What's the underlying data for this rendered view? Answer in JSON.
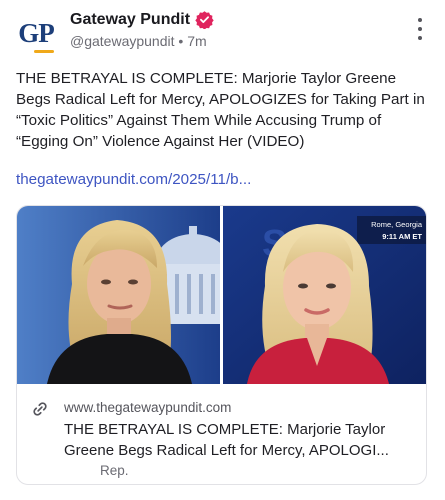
{
  "header": {
    "avatar_text": "GP",
    "account_name": "Gateway Pundit",
    "handle": "@gatewaypundit",
    "separator": "•",
    "time_ago": "7m",
    "more_icon": "more-vertical-icon",
    "verified_icon": "verified-badge-icon",
    "verified_color": "#e0245e"
  },
  "post": {
    "text": "THE BETRAYAL IS COMPLETE: Marjorie Taylor Greene Begs Radical Left for Mercy, APOLOGIZES for Taking Part in “Toxic Politics” Against Them While Accusing Trump of “Egging On” Violence Against Her (VIDEO)",
    "link_text": "thegatewaypundit.com/2025/11/b...",
    "link_color": "#3e55c2"
  },
  "link_card": {
    "thumbnail_overlay": {
      "location": "Rome, Georgia",
      "time": "9:11 AM ET",
      "bg_text": "St"
    },
    "link_icon": "link-icon",
    "domain": "www.thegatewaypundit.com",
    "title_line1": "THE BETRAYAL IS COMPLETE: Marjorie Taylor",
    "title_line2": "Greene Begs Radical Left for Mercy, APOLOGI...",
    "footer": "Rep."
  }
}
